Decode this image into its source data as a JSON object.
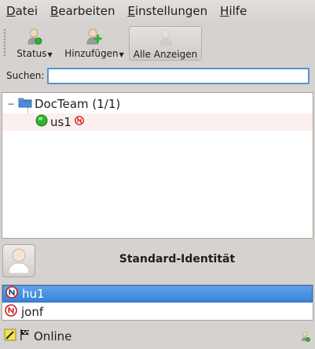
{
  "menubar": {
    "items": [
      {
        "mnemonic": "D",
        "rest": "atei"
      },
      {
        "mnemonic": "B",
        "rest": "earbeiten"
      },
      {
        "mnemonic": "E",
        "rest": "instellungen"
      },
      {
        "mnemonic": "H",
        "rest": "ilfe"
      }
    ]
  },
  "toolbar": {
    "status_label": "Status",
    "add_label": "Hinzufügen",
    "show_all_label": "Alle Anzeigen",
    "show_all_pressed": true
  },
  "search": {
    "label": "Suchen:",
    "value": "",
    "placeholder": ""
  },
  "contacts": {
    "group": {
      "name": "DocTeam (1/1)",
      "expanded": true
    },
    "items": [
      {
        "name": "us1",
        "status": "online",
        "protocol_icon": "novell-icon"
      }
    ]
  },
  "identity": {
    "title": "Standard-Identität"
  },
  "accounts": {
    "items": [
      {
        "name": "hu1",
        "selected": true
      },
      {
        "name": "jonf",
        "selected": false
      }
    ]
  },
  "statusbar": {
    "status_text": "Online"
  },
  "colors": {
    "selection": "#3a82d6",
    "online_green": "#2db52d",
    "protocol_red": "#d21e1e",
    "search_focus": "#5a8fd6"
  }
}
